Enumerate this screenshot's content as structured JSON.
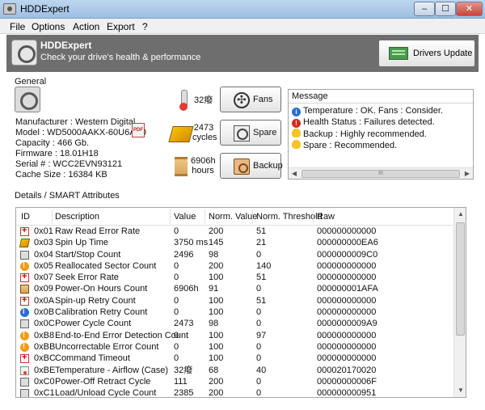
{
  "window": {
    "title": "HDDExpert",
    "min_glyph": "–",
    "max_glyph": "☐",
    "close_glyph": "✕"
  },
  "menu": [
    "File",
    "Options",
    "Action",
    "Export",
    "?"
  ],
  "header": {
    "title": "HDDExpert",
    "subtitle": "Check your drive's health & performance",
    "drivers_button": "Drivers Update"
  },
  "general": {
    "section_label": "General",
    "manufacturer": "Manufacturer : Western Digital",
    "model": "Model : WD5000AAKX-60U6AA0",
    "capacity": "Capacity : 466 Gb.",
    "firmware": "Firmware : 18.01H18",
    "serial": "Serial # : WCC2EVN93121",
    "cache": "Cache Size : 16384 KB"
  },
  "stats": {
    "temperature": "32癈",
    "cycles_value": "2473",
    "cycles_unit": "cycles",
    "hours_value": "6906h",
    "hours_unit": "hours"
  },
  "buttons": {
    "fans": "Fans",
    "spare": "Spare",
    "backup": "Backup"
  },
  "messages": {
    "header": "Message",
    "items": [
      {
        "type": "info",
        "text": "Temperature : OK. Fans : Consider."
      },
      {
        "type": "error",
        "text": "Health Status : Failures detected."
      },
      {
        "type": "bulb",
        "text": "Backup : Highly recommended."
      },
      {
        "type": "bulb",
        "text": "Spare : Recommended."
      }
    ]
  },
  "details": {
    "section_label": "Details / SMART Attributes",
    "columns": [
      "ID",
      "Description",
      "Value",
      "Norm. Value",
      "Norm. Threshold",
      "Raw"
    ],
    "rows": [
      {
        "icon": "plus",
        "id": "0x01",
        "desc": "Raw Read Error Rate",
        "value": "0",
        "norm": "200",
        "thr": "51",
        "raw": "000000000000"
      },
      {
        "icon": "spin",
        "id": "0x03",
        "desc": "Spin Up Time",
        "value": "3750 ms",
        "norm": "145",
        "thr": "21",
        "raw": "000000000EA6"
      },
      {
        "icon": "box",
        "id": "0x04",
        "desc": "Start/Stop Count",
        "value": "2496",
        "norm": "98",
        "thr": "0",
        "raw": "0000000009C0"
      },
      {
        "icon": "warn",
        "id": "0x05",
        "desc": "Reallocated Sector Count",
        "value": "0",
        "norm": "200",
        "thr": "140",
        "raw": "000000000000"
      },
      {
        "icon": "plus",
        "id": "0x07",
        "desc": "Seek Error Rate",
        "value": "0",
        "norm": "100",
        "thr": "51",
        "raw": "000000000000"
      },
      {
        "icon": "hour",
        "id": "0x09",
        "desc": "Power-On Hours Count",
        "value": "6906h",
        "norm": "91",
        "thr": "0",
        "raw": "000000001AFA"
      },
      {
        "icon": "plus",
        "id": "0x0A",
        "desc": "Spin-up Retry Count",
        "value": "0",
        "norm": "100",
        "thr": "51",
        "raw": "000000000000"
      },
      {
        "icon": "info",
        "id": "0x0B",
        "desc": "Calibration Retry Count",
        "value": "0",
        "norm": "100",
        "thr": "0",
        "raw": "000000000000"
      },
      {
        "icon": "box",
        "id": "0x0C",
        "desc": "Power Cycle Count",
        "value": "2473",
        "norm": "98",
        "thr": "0",
        "raw": "0000000009A9"
      },
      {
        "icon": "warn",
        "id": "0xB8",
        "desc": "End-to-End Error Detection Count",
        "value": "0",
        "norm": "100",
        "thr": "97",
        "raw": "000000000000"
      },
      {
        "icon": "warn",
        "id": "0xBB",
        "desc": "Uncorrectable Error Count",
        "value": "0",
        "norm": "100",
        "thr": "0",
        "raw": "000000000000"
      },
      {
        "icon": "plus",
        "id": "0xBC",
        "desc": "Command Timeout",
        "value": "0",
        "norm": "100",
        "thr": "0",
        "raw": "000000000000"
      },
      {
        "icon": "temp",
        "id": "0xBE",
        "desc": "Temperature - Airflow (Case)",
        "value": "32癈",
        "norm": "68",
        "thr": "40",
        "raw": "000020170020"
      },
      {
        "icon": "box",
        "id": "0xC0",
        "desc": "Power-Off Retract Cycle",
        "value": "111",
        "norm": "200",
        "thr": "0",
        "raw": "00000000006F"
      },
      {
        "icon": "box",
        "id": "0xC1",
        "desc": "Load/Unload Cycle Count",
        "value": "2385",
        "norm": "200",
        "thr": "0",
        "raw": "000000000951"
      }
    ]
  },
  "scroll": {
    "left": "◀",
    "right": "▶",
    "up": "▲",
    "down": "▼",
    "grip": "III"
  }
}
